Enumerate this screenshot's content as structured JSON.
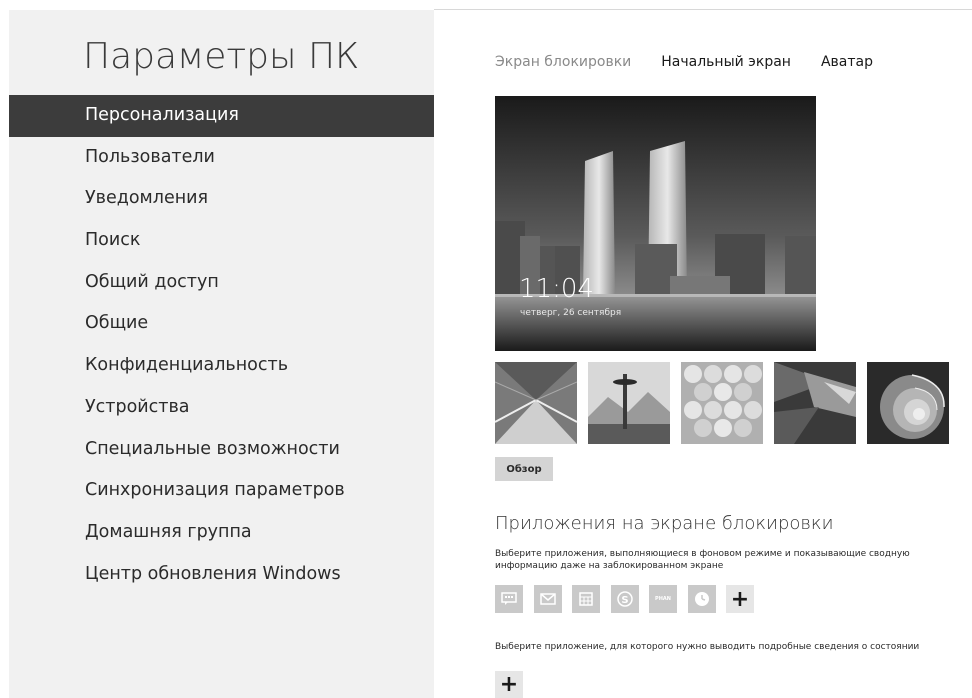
{
  "app_title": "Параметры ПК",
  "nav": {
    "items": [
      {
        "label": "Персонализация",
        "active": true
      },
      {
        "label": "Пользователи"
      },
      {
        "label": "Уведомления"
      },
      {
        "label": "Поиск"
      },
      {
        "label": "Общий доступ"
      },
      {
        "label": "Общие"
      },
      {
        "label": "Конфиденциальность"
      },
      {
        "label": "Устройства"
      },
      {
        "label": "Специальные возможности"
      },
      {
        "label": "Синхронизация параметров"
      },
      {
        "label": "Домашняя группа"
      },
      {
        "label": "Центр обновления Windows"
      }
    ]
  },
  "tabs": [
    {
      "label": "Экран блокировки",
      "active": true
    },
    {
      "label": "Начальный экран"
    },
    {
      "label": "Аватар"
    }
  ],
  "lock_preview": {
    "time": "11:04",
    "date": "четверг, 26 сентября"
  },
  "thumbnails": [
    "tunnel-image",
    "space-needle-image",
    "hexagon-image",
    "geometric-image",
    "nautilus-shell-image"
  ],
  "browse_button": "Обзор",
  "lock_apps": {
    "title": "Приложения на экране блокировки",
    "description": "Выберите приложения, выполняющиеся в фоновом режиме и показывающие сводную информацию даже на заблокированном экране",
    "icons": [
      {
        "name": "messaging-icon",
        "glyph": "✉"
      },
      {
        "name": "mail-icon",
        "glyph": "✉"
      },
      {
        "name": "calendar-icon",
        "glyph": "▦"
      },
      {
        "name": "skype-icon",
        "glyph": "S"
      },
      {
        "name": "phan-icon",
        "glyph": "PHAN"
      },
      {
        "name": "alarm-icon",
        "glyph": "◷"
      }
    ],
    "add_glyph": "+",
    "detail_description": "Выберите приложение, для которого нужно выводить подробные сведения о состоянии",
    "detail_add_glyph": "+"
  }
}
